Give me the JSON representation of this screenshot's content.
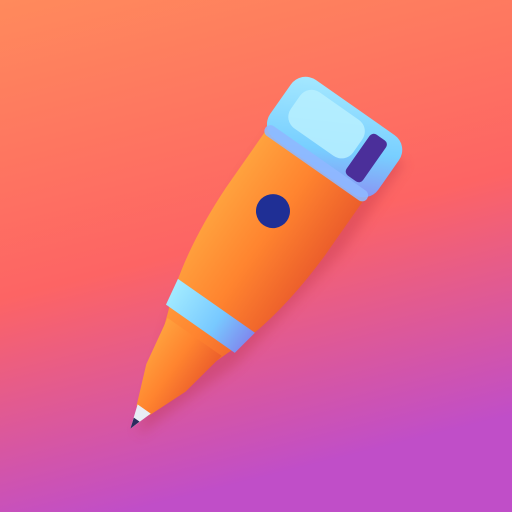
{
  "icon": {
    "name": "pen-icon",
    "background": {
      "top": "#ff8a5c",
      "middle": "#fd6464",
      "bottom": "#c04ec8"
    },
    "colors": {
      "body_light": "#ff9a3c",
      "body_main": "#ff7e2e",
      "body_shadow": "#e85a2a",
      "accent_light": "#9fe6ff",
      "accent_main": "#6fc8ff",
      "accent_shadow": "#7a8cf0",
      "dot": "#1f2f95",
      "slot": "#4b2f9a",
      "nib_tip": "#2c2c5e",
      "nib_metal": "#e8ecf5"
    }
  }
}
